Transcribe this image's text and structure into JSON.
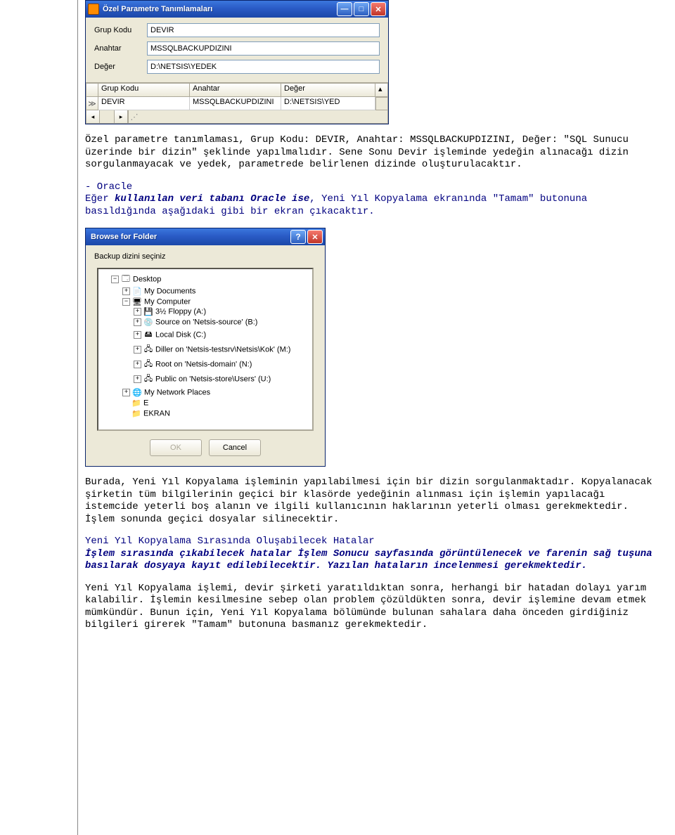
{
  "win1": {
    "title": "Özel Parametre Tanımlamaları",
    "fields": {
      "grup_kodu_label": "Grup Kodu",
      "grup_kodu_value": "DEVIR",
      "anahtar_label": "Anahtar",
      "anahtar_value": "MSSQLBACKUPDIZINI",
      "deger_label": "Değer",
      "deger_value": "D:\\NETSIS\\YEDEK"
    },
    "grid": {
      "headers": [
        "Grup Kodu",
        "Anahtar",
        "Değer"
      ],
      "row": [
        "DEVIR",
        "MSSQLBACKUPDIZINI",
        "D:\\NETSIS\\YED"
      ]
    }
  },
  "para1": "Özel parametre tanımlaması, Grup Kodu: DEVIR, Anahtar: MSSQLBACKUPDIZINI, Değer: \"SQL Sunucu üzerinde bir dizin\" şeklinde yapılmalıdır. Sene Sonu Devir işleminde yedeğin alınacağı dizin sorgulanmayacak ve yedek, parametrede belirlenen dizinde oluşturulacaktır.",
  "para2a": "- Oracle",
  "para2b_pre": "Eğer ",
  "para2b_bold": "kullanılan veri tabanı Oracle ise",
  "para2b_post": ", Yeni Yıl Kopyalama ekranında \"Tamam\" butonuna basıldığında aşağıdaki gibi bir ekran çıkacaktır.",
  "win2": {
    "title": "Browse for Folder",
    "msg": "Backup dizini seçiniz",
    "tree": {
      "desktop": "Desktop",
      "mydocs": "My Documents",
      "mycomp": "My Computer",
      "floppy": "3½ Floppy (A:)",
      "srcb": "Source on 'Netsis-source' (B:)",
      "localc": "Local Disk (C:)",
      "dillerm": "Diller on 'Netsis-testsrv\\Netsis\\Kok' (M:)",
      "rootn": "Root on 'Netsis-domain' (N:)",
      "publicu": "Public on 'Netsis-store\\Users' (U:)",
      "netplaces": "My Network Places",
      "e": "E",
      "ekran": "EKRAN"
    },
    "ok": "OK",
    "cancel": "Cancel"
  },
  "para3": "Burada, Yeni Yıl Kopyalama işleminin yapılabilmesi için bir dizin sorgulanmaktadır. Kopyalanacak şirketin tüm bilgilerinin geçici bir klasörde yedeğinin alınması için işlemin yapılacağı istemcide yeterli boş alanın ve ilgili kullanıcının haklarının yeterli olması gerekmektedir. İşlem sonunda geçici dosyalar silinecektir.",
  "para4_title": "Yeni Yıl Kopyalama Sırasında Oluşabilecek Hatalar",
  "para4_body": "İşlem sırasında çıkabilecek hatalar İşlem Sonucu sayfasında görüntülenecek ve farenin sağ tuşuna basılarak dosyaya kayıt edilebilecektir. Yazılan hataların incelenmesi gerekmektedir.",
  "para5": "Yeni Yıl Kopyalama işlemi, devir şirketi yaratıldıktan sonra, herhangi bir hatadan dolayı yarım kalabilir. İşlemin kesilmesine sebep olan problem çözüldükten sonra, devir işlemine devam etmek mümkündür. Bunun için, Yeni Yıl Kopyalama bölümünde bulunan sahalara daha önceden girdiğiniz bilgileri girerek \"Tamam\" butonuna basmanız gerekmektedir."
}
